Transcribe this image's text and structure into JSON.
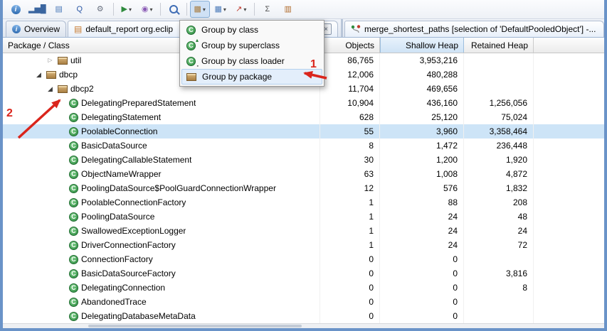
{
  "colors": {
    "window_border": "#6a93c8",
    "selection_bg": "#cde4f7",
    "sorted_header_bg": "#cfe3f5",
    "menu_highlight_bg": "#e3eefb",
    "annotation_red": "#da251c",
    "class_icon_green": "#2b8a3e",
    "package_icon_brown": "#a97e42"
  },
  "toolbar": {
    "icons": [
      {
        "name": "info-icon",
        "glyph": "i",
        "cls": "ic-round"
      },
      {
        "name": "histogram-icon",
        "glyph": "▂▅█",
        "color": "#3b66a0"
      },
      {
        "name": "dominator-tree-icon",
        "glyph": "▤",
        "color": "#4a79b8"
      },
      {
        "name": "oql-icon",
        "glyph": "Q",
        "color": "#2b57a5"
      },
      {
        "name": "thread-overview-icon",
        "glyph": "⚙",
        "color": "#6b7280",
        "sep_after": true
      },
      {
        "name": "run-expert-test-icon",
        "glyph": "▶",
        "color": "#2e8b3d",
        "dropdown": true
      },
      {
        "name": "query-browser-icon",
        "glyph": "◉",
        "color": "#8a5ab5",
        "dropdown": true,
        "sep_after": true
      },
      {
        "name": "search-icon",
        "glyph": "",
        "cls": "mag",
        "sep_after": true
      },
      {
        "name": "group-by-icon",
        "glyph": "▩",
        "color": "#a97e42",
        "dropdown": true,
        "pressed": true
      },
      {
        "name": "customize-table-icon",
        "glyph": "▦",
        "color": "#4a79b8",
        "dropdown": true
      },
      {
        "name": "chart-icon",
        "glyph": "↗",
        "color": "#c0392b",
        "dropdown": true,
        "sep_after": true
      },
      {
        "name": "calculate-retained-size-icon",
        "glyph": "Σ",
        "color": "#555555"
      },
      {
        "name": "compare-icon",
        "glyph": "▥",
        "color": "#b06a2a"
      }
    ]
  },
  "tabs": [
    {
      "label": "Overview"
    },
    {
      "label": "default_report org.eclip"
    },
    {
      "label": "merge_shortest_paths [selection of 'DefaultPooledObject'] -..."
    }
  ],
  "context_menu": {
    "items": [
      {
        "label": "Group by class"
      },
      {
        "label": "Group by superclass"
      },
      {
        "label": "Group by class loader"
      },
      {
        "label": "Group by package",
        "highlighted": true
      }
    ]
  },
  "table": {
    "columns": [
      "Package / Class",
      "Objects",
      "Shallow Heap",
      "Retained Heap"
    ],
    "sort_column": "Shallow Heap",
    "rows": [
      {
        "type": "package",
        "label": "util",
        "indent": 2,
        "expanded": false,
        "objects": "86,765",
        "shallow_heap": "3,953,216",
        "retained_heap": ""
      },
      {
        "type": "package",
        "label": "dbcp",
        "indent": 1,
        "expanded": true,
        "objects": "12,006",
        "shallow_heap": "480,288",
        "retained_heap": ""
      },
      {
        "type": "package",
        "label": "dbcp2",
        "indent": 2,
        "expanded": true,
        "objects": "11,704",
        "shallow_heap": "469,656",
        "retained_heap": ""
      },
      {
        "type": "class",
        "label": "DelegatingPreparedStatement",
        "indent": 3,
        "objects": "10,904",
        "shallow_heap": "436,160",
        "retained_heap": "1,256,056"
      },
      {
        "type": "class",
        "label": "DelegatingStatement",
        "indent": 3,
        "objects": "628",
        "shallow_heap": "25,120",
        "retained_heap": "75,024"
      },
      {
        "type": "class",
        "label": "PoolableConnection",
        "indent": 3,
        "selected": true,
        "objects": "55",
        "shallow_heap": "3,960",
        "retained_heap": "3,358,464"
      },
      {
        "type": "class",
        "label": "BasicDataSource",
        "indent": 3,
        "objects": "8",
        "shallow_heap": "1,472",
        "retained_heap": "236,448"
      },
      {
        "type": "class",
        "label": "DelegatingCallableStatement",
        "indent": 3,
        "objects": "30",
        "shallow_heap": "1,200",
        "retained_heap": "1,920"
      },
      {
        "type": "class",
        "label": "ObjectNameWrapper",
        "indent": 3,
        "objects": "63",
        "shallow_heap": "1,008",
        "retained_heap": "4,872"
      },
      {
        "type": "class",
        "label": "PoolingDataSource$PoolGuardConnectionWrapper",
        "indent": 3,
        "objects": "12",
        "shallow_heap": "576",
        "retained_heap": "1,832"
      },
      {
        "type": "class",
        "label": "PoolableConnectionFactory",
        "indent": 3,
        "objects": "1",
        "shallow_heap": "88",
        "retained_heap": "208"
      },
      {
        "type": "class",
        "label": "PoolingDataSource",
        "indent": 3,
        "objects": "1",
        "shallow_heap": "24",
        "retained_heap": "48"
      },
      {
        "type": "class",
        "label": "SwallowedExceptionLogger",
        "indent": 3,
        "objects": "1",
        "shallow_heap": "24",
        "retained_heap": "24"
      },
      {
        "type": "class",
        "label": "DriverConnectionFactory",
        "indent": 3,
        "objects": "1",
        "shallow_heap": "24",
        "retained_heap": "72"
      },
      {
        "type": "class",
        "label": "ConnectionFactory",
        "indent": 3,
        "objects": "0",
        "shallow_heap": "0",
        "retained_heap": ""
      },
      {
        "type": "class",
        "label": "BasicDataSourceFactory",
        "indent": 3,
        "objects": "0",
        "shallow_heap": "0",
        "retained_heap": "3,816"
      },
      {
        "type": "class",
        "label": "DelegatingConnection",
        "indent": 3,
        "objects": "0",
        "shallow_heap": "0",
        "retained_heap": "8"
      },
      {
        "type": "class",
        "label": "AbandonedTrace",
        "indent": 3,
        "objects": "0",
        "shallow_heap": "0",
        "retained_heap": ""
      },
      {
        "type": "class",
        "label": "DelegatingDatabaseMetaData",
        "indent": 3,
        "objects": "0",
        "shallow_heap": "0",
        "retained_heap": ""
      }
    ]
  },
  "annotations": {
    "step1": "1",
    "step2": "2"
  }
}
